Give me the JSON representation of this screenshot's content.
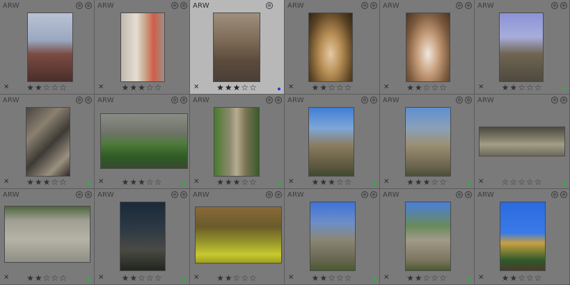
{
  "lighttable": {
    "cells": [
      {
        "format": "ARW",
        "stars": 2,
        "selected": false,
        "label": "",
        "thumb": "linear-gradient(180deg,#b9c3d6 0%,#9aa7bf 40%,#7b4c43 60%,#4a2e2a 100%)"
      },
      {
        "format": "ARW",
        "stars": 3,
        "selected": false,
        "label": "",
        "thumb": "linear-gradient(90deg,#bfb9ad 0%,#e5ded3 35%,#c8a98c 55%,#d25e48 75%,#9d8f86 100%)"
      },
      {
        "format": "ARW",
        "stars": 3,
        "selected": true,
        "label": "#2233ee",
        "thumb": "linear-gradient(180deg,#9f8f7c 0%,#7d6a57 40%,#5c4a3c 70%,#4a3f38 100%)"
      },
      {
        "format": "ARW",
        "stars": 2,
        "selected": false,
        "label": "",
        "thumb": "radial-gradient(ellipse at 50% 60%,#e4c9a5 0%,#b78f55 35%,#5a4122 75%,#2f2616 100%)"
      },
      {
        "format": "ARW",
        "stars": 2,
        "selected": false,
        "label": "",
        "thumb": "radial-gradient(ellipse at 50% 60%,#efe7df 0%,#c79e7c 35%,#7d5a3d 70%,#4a3526 100%)"
      },
      {
        "format": "ARW",
        "stars": 2,
        "selected": false,
        "label": "#22bb33",
        "thumb": "linear-gradient(180deg,#8b93d8 0%,#a7add9 35%,#6e6552 60%,#4f4a3e 100%)"
      },
      {
        "format": "ARW",
        "stars": 3,
        "selected": false,
        "label": "#22bb33",
        "thumb": "linear-gradient(135deg,#4a4540 0%,#8a8070 30%,#3e3a35 55%,#9a9080 80%,#2e2a26 100%)"
      },
      {
        "format": "ARW",
        "stars": 3,
        "selected": false,
        "label": "#22bb33",
        "thumb": "linear-gradient(180deg,#8a8d84 0%,#6f736a 35%,#4f7a3a 55%,#2e5a24 80%,#3a4a30 100%)"
      },
      {
        "format": "ARW",
        "stars": 3,
        "selected": false,
        "label": "#22bb33",
        "thumb": "linear-gradient(90deg,#4a7a2e 0%,#8e8a70 35%,#b7ad90 50%,#7a7455 70%,#3a5a2a 100%)"
      },
      {
        "format": "ARW",
        "stars": 3,
        "selected": false,
        "label": "#22bb33",
        "thumb": "linear-gradient(180deg,#3f7fd6 0%,#7ea6d8 30%,#8b7d60 55%,#5e583f 85%,#3f4a30 100%)"
      },
      {
        "format": "ARW",
        "stars": 3,
        "selected": false,
        "label": "#22bb33",
        "thumb": "linear-gradient(180deg,#5f8fd0 0%,#8aa0b9 30%,#9b8f72 55%,#6d6550 85%,#4a5038 100%)"
      },
      {
        "format": "ARW",
        "stars": 0,
        "selected": false,
        "label": "#22bb33",
        "thumb": "linear-gradient(180deg,#4a4a42 0%,#8a8570 45%,#a39e88 60%,#6d6a5c 100%)"
      },
      {
        "format": "ARW",
        "stars": 2,
        "selected": false,
        "label": "#22bb33",
        "thumb": "linear-gradient(180deg,#4f6640 0%,#9f9f92 25%,#b5b3a6 60%,#8f8e84 100%)"
      },
      {
        "format": "ARW",
        "stars": 2,
        "selected": false,
        "label": "#22bb33",
        "thumb": "linear-gradient(180deg,#1a2a3a 0%,#2e3a44 40%,#4a4a44 70%,#22251f 100%)"
      },
      {
        "format": "ARW",
        "stars": 2,
        "selected": false,
        "label": "",
        "thumb": "linear-gradient(180deg,#8a6a3a 0%,#6a5a2a 35%,#9a9a2a 65%,#c8c832 85%,#a0a01e 100%)"
      },
      {
        "format": "ARW",
        "stars": 2,
        "selected": false,
        "label": "#22bb33",
        "thumb": "linear-gradient(180deg,#3f73d8 0%,#6c8ec8 30%,#8a8776 55%,#6f6a58 80%,#4a5a30 100%)"
      },
      {
        "format": "ARW",
        "stars": 2,
        "selected": false,
        "label": "#22bb33",
        "thumb": "linear-gradient(180deg,#4a7fd8 0%,#6a8a5a 35%,#a09a88 55%,#7d7560 85%,#4a5a2e 100%)"
      },
      {
        "format": "ARW",
        "stars": 2,
        "selected": false,
        "label": "",
        "thumb": "linear-gradient(180deg,#2a6ae0 0%,#3a7ae6 45%,#c8a040 60%,#2e5a2a 85%,#4a3a2a 100%)"
      }
    ],
    "star_total": 5,
    "star_filled_char": "★",
    "star_empty_char": "☆",
    "reject_char": "✕",
    "group_icon_char": "⊕",
    "altered_icon_char": "⊗"
  }
}
